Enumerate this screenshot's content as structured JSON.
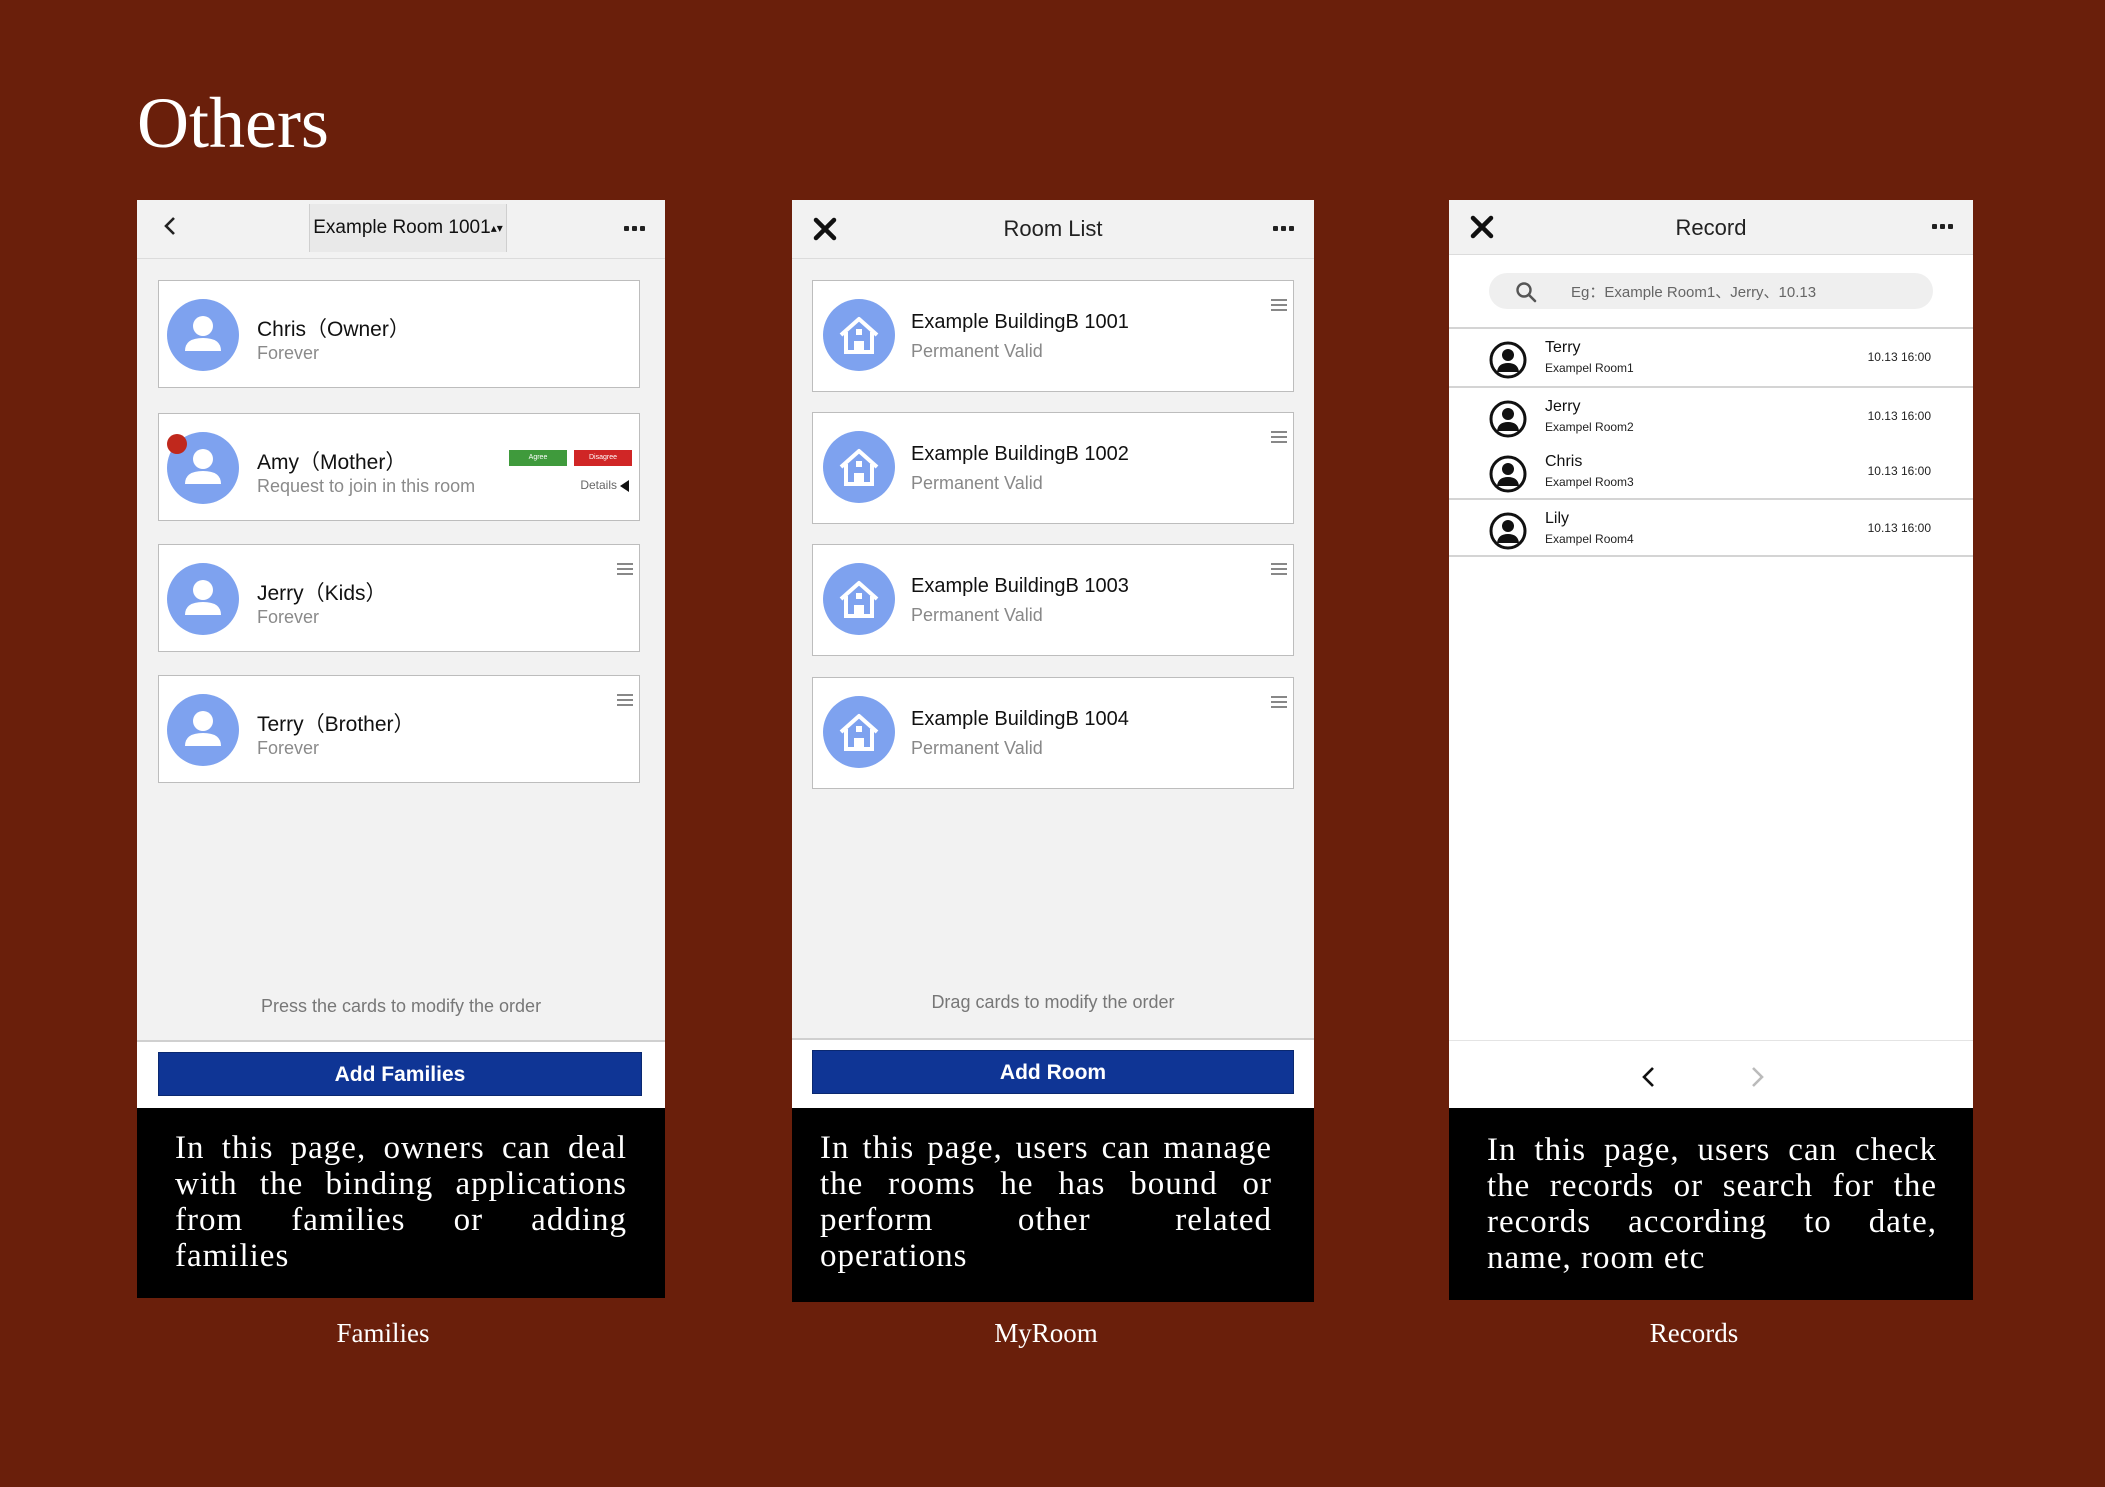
{
  "page": {
    "title": "Others"
  },
  "families": {
    "room_selector": "Example Room 1001",
    "members": [
      {
        "name": "Chris（Owner）",
        "sub": "Forever"
      },
      {
        "name": "Amy（Mother）",
        "sub": "Request to join in this room",
        "agree": "Agree",
        "disagree": "Disagree",
        "details": "Details"
      },
      {
        "name": "Jerry（Kids）",
        "sub": "Forever"
      },
      {
        "name": "Terry（Brother）",
        "sub": "Forever"
      }
    ],
    "hint": "Press the cards to modify the order",
    "button": "Add Families",
    "description": "In this page, owners can deal with the binding applications from families or adding families",
    "caption": "Families"
  },
  "myroom": {
    "title": "Room List",
    "rooms": [
      {
        "name": "Example BuildingB 1001",
        "sub": "Permanent Valid"
      },
      {
        "name": "Example BuildingB 1002",
        "sub": "Permanent Valid"
      },
      {
        "name": "Example BuildingB 1003",
        "sub": "Permanent Valid"
      },
      {
        "name": "Example BuildingB 1004",
        "sub": "Permanent Valid"
      }
    ],
    "hint": "Drag cards to modify the order",
    "button": "Add Room",
    "description": "In this page, users can manage the rooms he has bound or perform other related operations",
    "caption": "MyRoom"
  },
  "records": {
    "title": "Record",
    "search_placeholder": "Eg：Example Room1、Jerry、10.13",
    "items": [
      {
        "name": "Terry",
        "room": "Exampel Room1",
        "time": "10.13 16:00"
      },
      {
        "name": "Jerry",
        "room": "Exampel Room2",
        "time": "10.13 16:00"
      },
      {
        "name": "Chris",
        "room": "Exampel Room3",
        "time": "10.13 16:00"
      },
      {
        "name": "Lily",
        "room": "Exampel Room4",
        "time": "10.13 16:00"
      }
    ],
    "description": "In this page, users can check the records or search for the records according to date, name, room etc",
    "caption": "Records"
  },
  "icons": {
    "back": "chevron-left-icon",
    "close": "close-icon",
    "more": "more-icon",
    "avatar": "person-icon",
    "building": "house-icon",
    "search": "search-icon",
    "drag": "drag-handle-icon"
  },
  "colors": {
    "background": "#6a1f0b",
    "primary_button": "#0f3595",
    "agree": "#3f9a3c",
    "disagree": "#d02626",
    "avatar": "#7ea2ef"
  }
}
